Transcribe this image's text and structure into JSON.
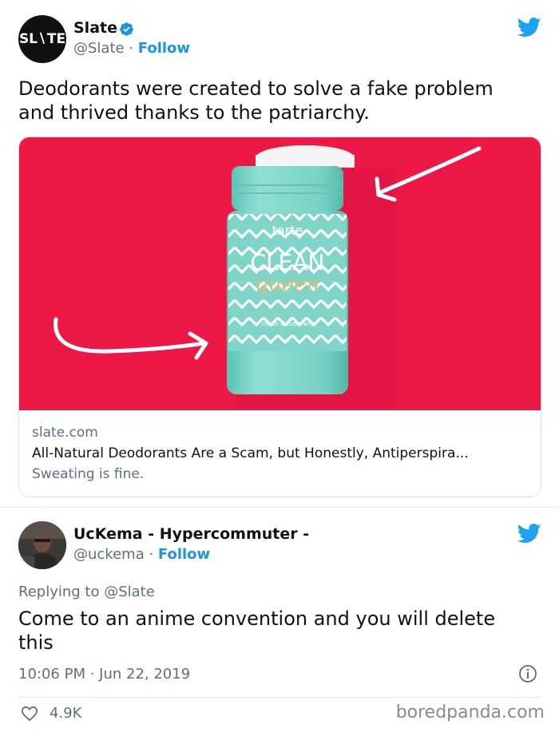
{
  "tweet1": {
    "avatar_text": "SL∖TE",
    "name": "Slate",
    "handle": "@Slate",
    "separator": " · ",
    "follow": "Follow",
    "text_line1": "Deodorants were created to solve a fake problem",
    "text_line2": "and thrived thanks to the patriarchy.",
    "card": {
      "domain": "slate.com",
      "title": "All-Natural Deodorants Are a Scam, but Honestly, Antiperspira...",
      "description": "Sweating is fine.",
      "product_brand": "tarte",
      "product_name_line1": "CLEAN",
      "product_name_line2": "queen",
      "product_fine_print": "clean deodorant"
    }
  },
  "tweet2": {
    "name": "UcKema - Hypercommuter -",
    "handle": "@uckema",
    "separator": " · ",
    "follow": "Follow",
    "replying": "Replying to @Slate",
    "text_line1": "Come to an anime convention and you will delete",
    "text_line2": "this",
    "timestamp": "10:06 PM · Jun 22, 2019",
    "likes": "4.9K",
    "watermark": "boredpanda.com"
  },
  "colors": {
    "twitter_blue": "#1b95e0",
    "card_bg": "#ee1847",
    "tube": "#7fd6c8",
    "heart": "#5b7083"
  }
}
